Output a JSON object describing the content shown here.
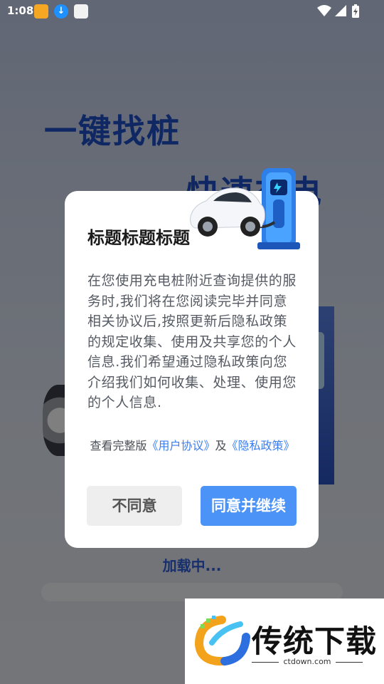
{
  "status_bar": {
    "time": "1:08",
    "icons": [
      "app-notification-icon",
      "download-icon",
      "app-notification-icon",
      "wifi-icon",
      "signal-icon",
      "battery-charging-icon"
    ]
  },
  "splash": {
    "headline_1": "一键找桩",
    "headline_2": "快速充电",
    "loading_text": "加载中...",
    "progress": 0.0
  },
  "dialog": {
    "title": "标题标题标题",
    "body": "在您使用充电桩附近查询提供的服务时,我们将在您阅读完毕并同意相关协议后,按照更新后隐私政策的规定收集、使用及共享您的个人信息.我们希望通过隐私政策向您介绍我们如何收集、处理、使用您的个人信息.",
    "links_prefix": "查看完整版",
    "user_agreement": "《用户协议》",
    "conjunction": "及",
    "privacy_policy": "《隐私政策》",
    "disagree_label": "不同意",
    "agree_label": "同意并继续",
    "accent_color": "#4b93f6"
  },
  "watermark": {
    "brand": "传统下载",
    "url": "ctdown.com"
  }
}
